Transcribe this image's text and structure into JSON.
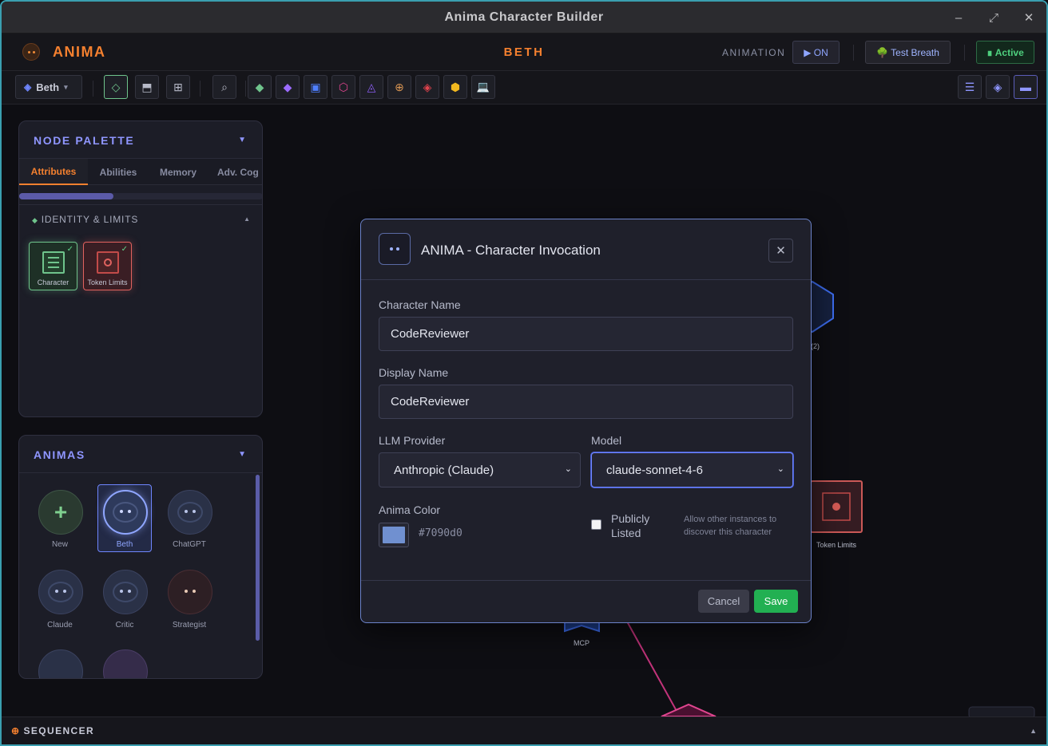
{
  "window": {
    "title": "Anima Character Builder",
    "controls": {
      "minimize": "–",
      "maximize": "⤢",
      "close": "✕"
    }
  },
  "header": {
    "brand": "ANIMA",
    "character": "BETH",
    "animation_label": "ANIMATION",
    "animation_toggle": "▶ ON",
    "test_breath": "🌳 Test Breath",
    "status": "∎ Active",
    "status_color": "#4ed07e",
    "accent_color": "#f4802f"
  },
  "toolbar": {
    "anima_selector": "Beth",
    "anima_selector_caret": "▾",
    "tools": [
      {
        "name": "select-tool-icon",
        "glyph": "◇"
      },
      {
        "name": "layout-top-icon",
        "glyph": "⬒"
      },
      {
        "name": "grid-icon",
        "glyph": "⊞"
      },
      {
        "name": "search-icon",
        "glyph": "⌕"
      }
    ],
    "node_types": [
      {
        "name": "attribute-node-icon",
        "glyph": "◆",
        "color": "#6fc48c"
      },
      {
        "name": "ability-node-icon",
        "glyph": "◆",
        "color": "#9b6bff"
      },
      {
        "name": "memory-node-icon",
        "glyph": "▣",
        "color": "#4f7fff"
      },
      {
        "name": "hexagon-node-icon",
        "glyph": "⬡",
        "color": "#e0458f"
      },
      {
        "name": "triangle-node-icon",
        "glyph": "◬",
        "color": "#8a5cf0"
      },
      {
        "name": "target-node-icon",
        "glyph": "⊕",
        "color": "#d99552"
      },
      {
        "name": "red-diamond-node-icon",
        "glyph": "◈",
        "color": "#e0434d"
      },
      {
        "name": "hex-gold-node-icon",
        "glyph": "⬢",
        "color": "#f2b81f"
      },
      {
        "name": "computer-node-icon",
        "glyph": "💻",
        "color": "#8ab4ff"
      }
    ],
    "right_tools": [
      {
        "name": "list-view-icon",
        "glyph": "☰"
      },
      {
        "name": "diamond-view-icon",
        "glyph": "◈"
      },
      {
        "name": "panel-view-icon",
        "glyph": "▬"
      }
    ]
  },
  "palette": {
    "title": "NODE PALETTE",
    "caret": "▼",
    "tabs": [
      "Attributes",
      "Abilities",
      "Memory",
      "Adv. Cog"
    ],
    "section": "IDENTITY & LIMITS",
    "section_icon": "◆",
    "section_caret": "▲",
    "tiles": [
      {
        "label": "Character",
        "check": "✓",
        "color": "#6fc48c"
      },
      {
        "label": "Token Limits",
        "check": "✓",
        "color": "#e0625f"
      }
    ]
  },
  "animas": {
    "title": "ANIMAS",
    "caret": "▼",
    "items": [
      {
        "label": "New"
      },
      {
        "label": "Beth"
      },
      {
        "label": "ChatGPT"
      },
      {
        "label": "Claude"
      },
      {
        "label": "Critic"
      },
      {
        "label": "Strategist"
      }
    ],
    "new_glyph": "+"
  },
  "canvas": {
    "node_labels": {
      "memory": "(2)",
      "token_limits": "Token Limits",
      "mcp": "MCP"
    }
  },
  "dialog": {
    "title": "ANIMA - Character Invocation",
    "close": "✕",
    "character_name_label": "Character Name",
    "character_name_value": "CodeReviewer",
    "display_name_label": "Display Name",
    "display_name_value": "CodeReviewer",
    "provider_label": "LLM Provider",
    "provider_value": "Anthropic (Claude)",
    "model_label": "Model",
    "model_value": "claude-sonnet-4-6",
    "color_label": "Anima Color",
    "color_value": "#7090d0",
    "public_label": "Publicly Listed",
    "public_hint": "Allow other instances to discover this character",
    "cancel": "Cancel",
    "save": "Save",
    "select_caret": "⌄"
  },
  "sequencer": {
    "icon": "⊕",
    "label": "SEQUENCER",
    "caret": "▲"
  }
}
